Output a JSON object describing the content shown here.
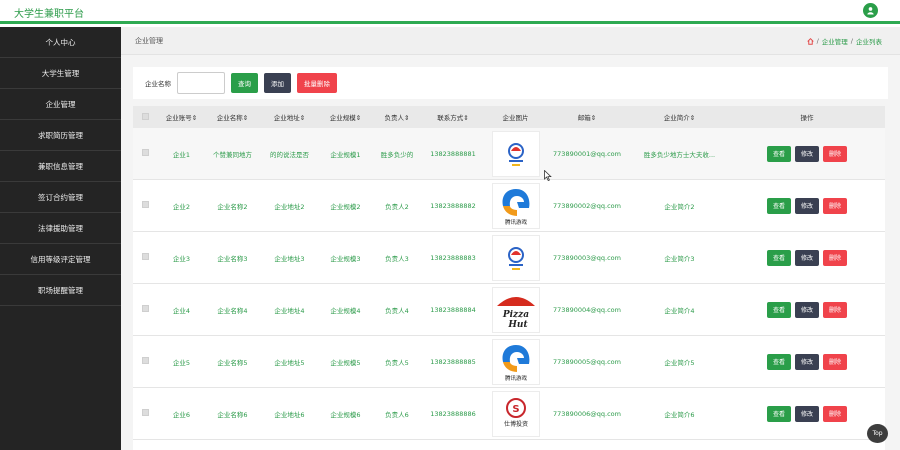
{
  "app": {
    "title": "大学生兼职平台"
  },
  "sidebar": {
    "items": [
      {
        "label": "个人中心"
      },
      {
        "label": "大学生管理"
      },
      {
        "label": "企业管理"
      },
      {
        "label": "求职简历管理"
      },
      {
        "label": "兼职信息管理"
      },
      {
        "label": "签订合约管理"
      },
      {
        "label": "法律援助管理"
      },
      {
        "label": "信用等级评定管理"
      },
      {
        "label": "职场提醒管理"
      }
    ]
  },
  "breadcrumb": {
    "title": "企业管理",
    "sep": "/",
    "level1": "企业管理",
    "level2": "企业列表"
  },
  "search": {
    "label": "企业名称",
    "query_btn": "查询",
    "add_btn": "添加",
    "batch_delete_btn": "批量删除"
  },
  "table": {
    "headers": [
      "企业账号⇕",
      "企业名称⇕",
      "企业地址⇕",
      "企业规模⇕",
      "负责人⇕",
      "联系方式⇕",
      "企业图片",
      "邮箱⇕",
      "企业简介⇕",
      "操作"
    ],
    "rows": [
      {
        "account": "企业1",
        "name": "个赞兼同地方",
        "address": "的的说法是否",
        "scale": "企业规模1",
        "leader": "胜多负少的",
        "phone": "13823888881",
        "logo": "logo-a",
        "email": "773890001@qq.com",
        "intro": "胜多负少地方士大夫收..."
      },
      {
        "account": "企业2",
        "name": "企业名称2",
        "address": "企业地址2",
        "scale": "企业规模2",
        "leader": "负责人2",
        "phone": "13823888882",
        "logo": "logo-game",
        "email": "773890002@qq.com",
        "intro": "企业简介2"
      },
      {
        "account": "企业3",
        "name": "企业名称3",
        "address": "企业地址3",
        "scale": "企业规模3",
        "leader": "负责人3",
        "phone": "13823888883",
        "logo": "logo-a",
        "email": "773890003@qq.com",
        "intro": "企业简介3"
      },
      {
        "account": "企业4",
        "name": "企业名称4",
        "address": "企业地址4",
        "scale": "企业规模4",
        "leader": "负责人4",
        "phone": "13823888884",
        "logo": "logo-pizza",
        "email": "773890004@qq.com",
        "intro": "企业简介4"
      },
      {
        "account": "企业5",
        "name": "企业名称5",
        "address": "企业地址5",
        "scale": "企业规模5",
        "leader": "负责人5",
        "phone": "13823888885",
        "logo": "logo-game",
        "email": "773890005@qq.com",
        "intro": "企业简介5"
      },
      {
        "account": "企业6",
        "name": "企业名称6",
        "address": "企业地址6",
        "scale": "企业规模6",
        "leader": "负责人6",
        "phone": "13823888886",
        "logo": "logo-s",
        "email": "773890006@qq.com",
        "intro": "企业简介6"
      }
    ],
    "actions": {
      "view": "查看",
      "edit": "修改",
      "delete": "删除"
    }
  },
  "logo_text": {
    "game": "腾讯游戏",
    "s": "仕博投资"
  },
  "top_button": "Top",
  "colors": {
    "accent": "#2a9e49",
    "dark": "#3a4052",
    "danger": "#f0434b",
    "sidebar": "#242424"
  }
}
